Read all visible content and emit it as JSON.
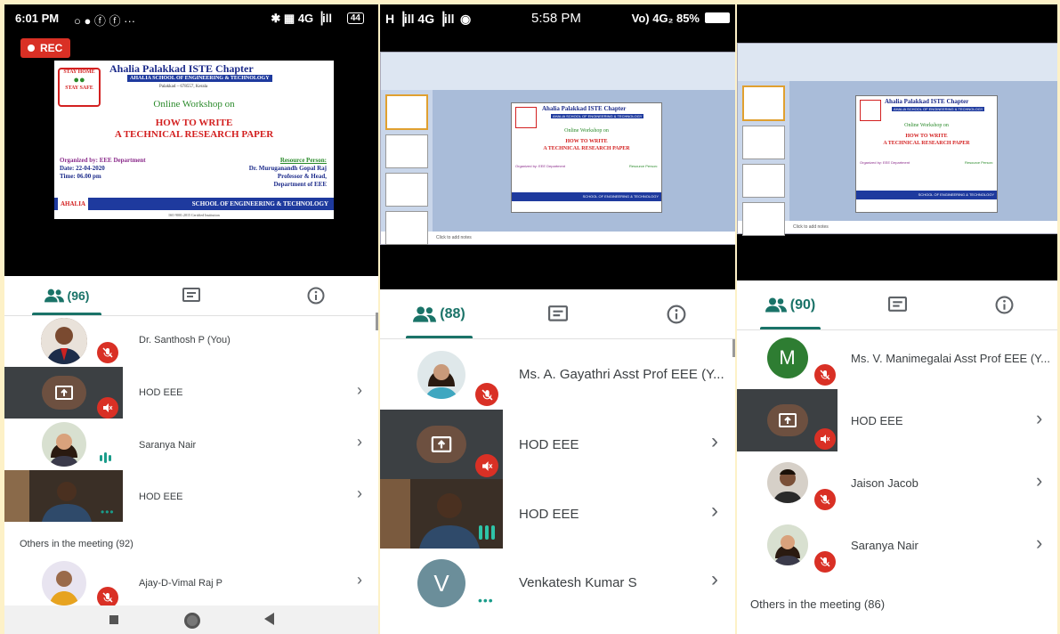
{
  "phone1": {
    "status": {
      "time": "6:01 PM",
      "icons_left": "○ ● ⓕ ⓕ ···",
      "icons_right": "✱ ▦ 4G▕ill",
      "battery": "44"
    },
    "rec_label": "REC",
    "poster": {
      "org": "Ahalia Palakkad ISTE Chapter",
      "school_badge": "AHALIA SCHOOL OF ENGINEERING & TECHNOLOGY",
      "address": "Palakkad – 678557, Kerala",
      "stay_home": "STAY HOME",
      "stay_safe": "STAY SAFE",
      "workshop": "Online Workshop on",
      "title_line1": "HOW TO WRITE",
      "title_line2": "A TECHNICAL RESEARCH PAPER",
      "organized": "Organized by: EEE Department",
      "date": "Date: 22-04-2020",
      "time": "Time: 06.00 pm",
      "resource_label": "Resource Person:",
      "resource_name": "Dr. Muruganandh Gopal Raj",
      "resource_role": "Professor & Head,",
      "resource_dept": "Department of EEE",
      "footer_brand": "AHALIA",
      "footer_school": "SCHOOL OF ENGINEERING & TECHNOLOGY",
      "footer_small": "ISO 9001:2015 Certified Institution"
    },
    "participant_count": "(96)",
    "participants": [
      {
        "name": "Dr. Santhosh P (You)"
      },
      {
        "name": "HOD EEE"
      },
      {
        "name": "Saranya Nair"
      },
      {
        "name": "HOD EEE"
      }
    ],
    "others_label": "Others in the meeting (92)",
    "others": [
      {
        "name": "Ajay-D-Vimal Raj P"
      }
    ]
  },
  "phone2": {
    "status": {
      "left": "H▕ill 4G▕ill",
      "time": "5:58 PM",
      "right": "Vo) 4G₂ 85%"
    },
    "ppt_notes": "Click to add notes",
    "participant_count": "(88)",
    "participants": [
      {
        "name": "Ms. A. Gayathri Asst Prof EEE (Y..."
      },
      {
        "name": "HOD EEE"
      },
      {
        "name": "HOD EEE"
      },
      {
        "name": "Venkatesh Kumar S",
        "initial": "V"
      }
    ]
  },
  "phone3": {
    "ppt_notes": "Click to add notes",
    "participant_count": "(90)",
    "participants": [
      {
        "name": "Ms. V. Manimegalai Asst Prof EEE (Y...",
        "initial": "M"
      },
      {
        "name": "HOD EEE"
      },
      {
        "name": "Jaison Jacob"
      },
      {
        "name": "Saranya Nair"
      }
    ],
    "others_label": "Others in the meeting (86)"
  },
  "colors": {
    "accent": "#1a7368",
    "mute": "#d93025",
    "rec": "#d93025",
    "frame_bg": "#fdf1c7"
  }
}
